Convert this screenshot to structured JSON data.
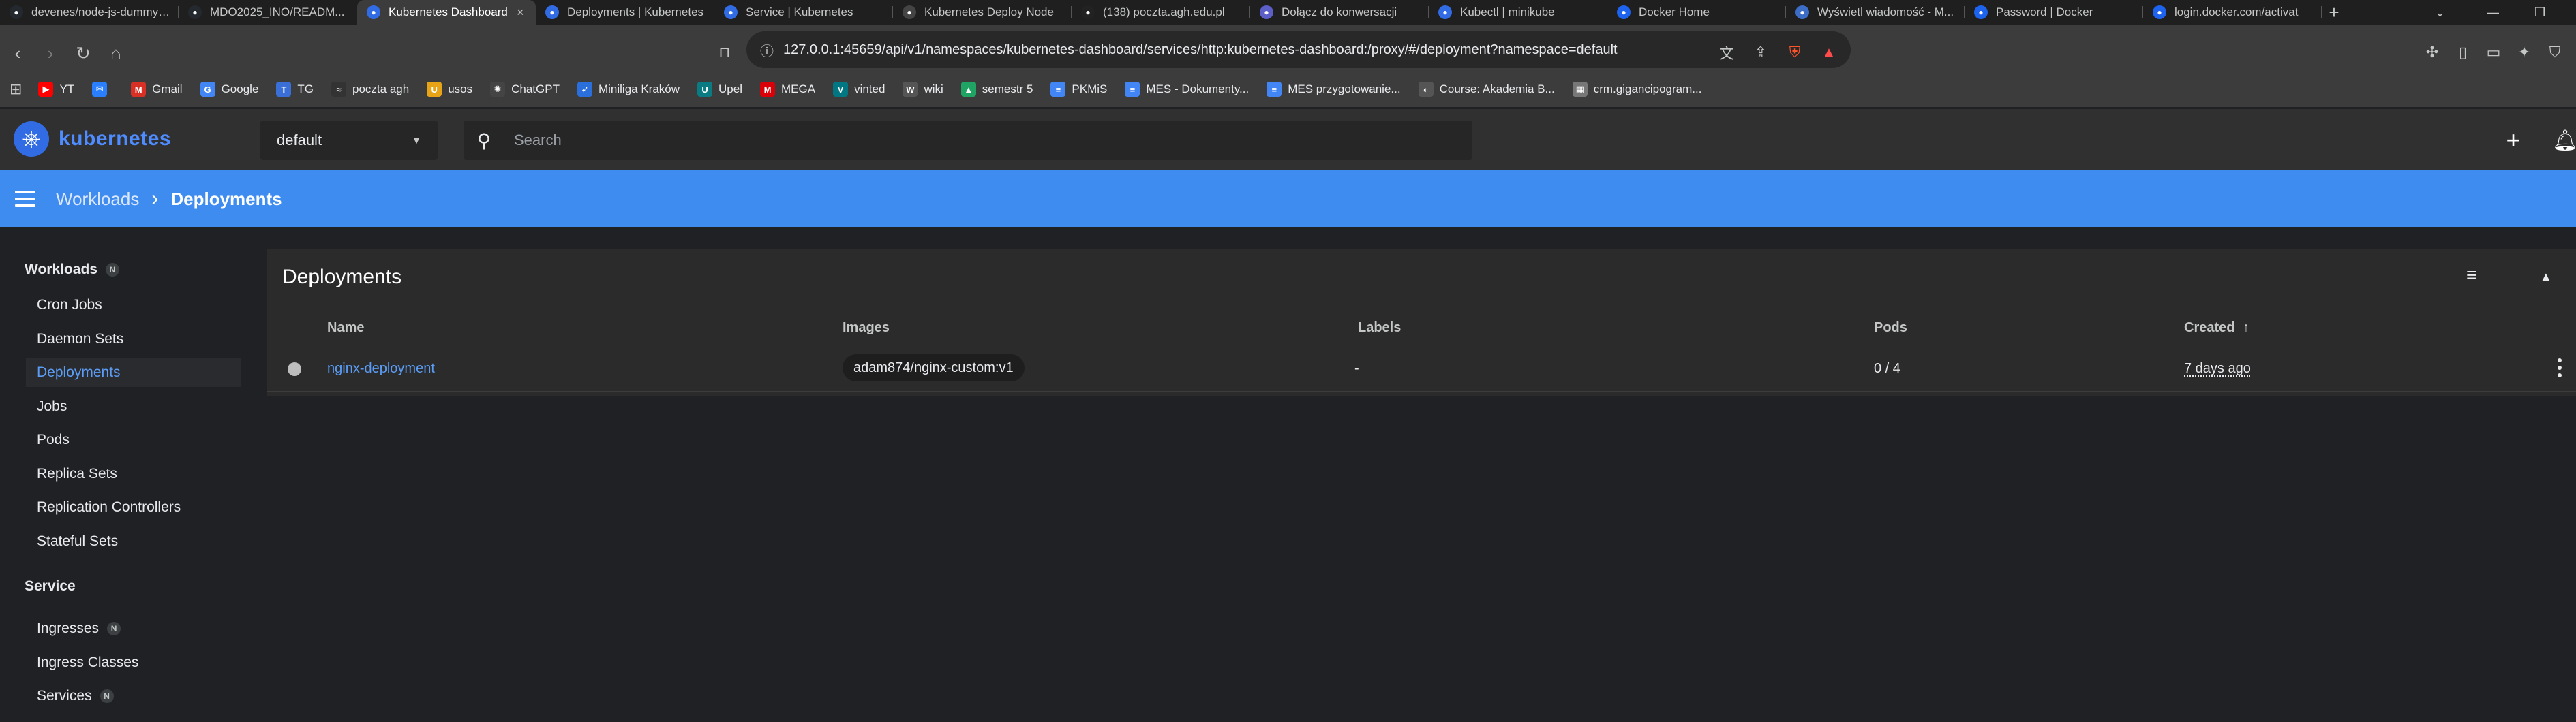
{
  "browser": {
    "tabs": [
      {
        "title": "devenes/node-js-dummy-test",
        "icon": "github-icon",
        "color": "#24292f",
        "active": false
      },
      {
        "title": "MDO2025_INO/READM...",
        "icon": "github-icon",
        "color": "#24292f",
        "active": false
      },
      {
        "title": "Kubernetes Dashboard",
        "icon": "kubernetes-icon",
        "color": "#326ce5",
        "active": true
      },
      {
        "title": "Deployments | Kubernetes",
        "icon": "kubernetes-icon",
        "color": "#326ce5",
        "active": false
      },
      {
        "title": "Service | Kubernetes",
        "icon": "kubernetes-icon",
        "color": "#326ce5",
        "active": false
      },
      {
        "title": "Kubernetes Deploy Node",
        "icon": "openai-icon",
        "color": "#444444",
        "active": false
      },
      {
        "title": "(138) poczta.agh.edu.pl",
        "icon": "mail-icon",
        "color": "#222222",
        "active": false
      },
      {
        "title": "Dołącz do konwersacji",
        "icon": "teams-icon",
        "color": "#5b5fc7",
        "active": false
      },
      {
        "title": "Kubectl | minikube",
        "icon": "minikube-icon",
        "color": "#326ce5",
        "active": false
      },
      {
        "title": "Docker Home",
        "icon": "docker-icon",
        "color": "#1d63ed",
        "active": false
      },
      {
        "title": "Wyświetl wiadomość - M...",
        "icon": "email-icon",
        "color": "#3c6ec7",
        "active": false
      },
      {
        "title": "Password | Docker",
        "icon": "docker-icon",
        "color": "#1d63ed",
        "active": false
      },
      {
        "title": "login.docker.com/activat",
        "icon": "docker-icon",
        "color": "#1d63ed",
        "active": false
      }
    ],
    "new_tab": "+",
    "url": "127.0.0.1:45659/api/v1/namespaces/kubernetes-dashboard/services/http:kubernetes-dashboard:/proxy/#/deployment?namespace=default",
    "bookmarks": [
      {
        "label": "YT",
        "icon": "youtube-icon",
        "color": "#ff0000",
        "glyph": "▶"
      },
      {
        "label": "",
        "icon": "messenger-icon",
        "color": "#2a7fff",
        "glyph": "✉"
      },
      {
        "label": "Gmail",
        "icon": "gmail-icon",
        "color": "#d93025",
        "glyph": "M"
      },
      {
        "label": "Google",
        "icon": "google-icon",
        "color": "#4285f4",
        "glyph": "G"
      },
      {
        "label": "TG",
        "icon": "tg-icon",
        "color": "#3b6fd8",
        "glyph": "T"
      },
      {
        "label": "poczta agh",
        "icon": "poczta-icon",
        "color": "#333333",
        "glyph": "≈"
      },
      {
        "label": "usos",
        "icon": "usos-icon",
        "color": "#e8a317",
        "glyph": "U"
      },
      {
        "label": "ChatGPT",
        "icon": "chatgpt-icon",
        "color": "#444444",
        "glyph": "✺"
      },
      {
        "label": "Miniliga Kraków",
        "icon": "miniliga-icon",
        "color": "#2a6fdb",
        "glyph": "➶"
      },
      {
        "label": "Upel",
        "icon": "upel-icon",
        "color": "#0a7b83",
        "glyph": "U"
      },
      {
        "label": "MEGA",
        "icon": "mega-icon",
        "color": "#d90007",
        "glyph": "M"
      },
      {
        "label": "vinted",
        "icon": "vinted-icon",
        "color": "#007782",
        "glyph": "V"
      },
      {
        "label": "wiki",
        "icon": "wiki-icon",
        "color": "#555555",
        "glyph": "W"
      },
      {
        "label": "semestr 5",
        "icon": "drive-icon",
        "color": "#1fa463",
        "glyph": "▲"
      },
      {
        "label": "PKMiS",
        "icon": "docs-icon",
        "color": "#4285f4",
        "glyph": "≡"
      },
      {
        "label": "MES - Dokumenty...",
        "icon": "docs-icon",
        "color": "#4285f4",
        "glyph": "≡"
      },
      {
        "label": "MES przygotowanie...",
        "icon": "docs-icon",
        "color": "#4285f4",
        "glyph": "≡"
      },
      {
        "label": "Course: Akademia B...",
        "icon": "course-icon",
        "color": "#555555",
        "glyph": "◐"
      },
      {
        "label": "crm.gigancipogram...",
        "icon": "crm-icon",
        "color": "#777777",
        "glyph": "▦"
      }
    ]
  },
  "app": {
    "brand": "kubernetes",
    "namespace": "default",
    "search_placeholder": "Search",
    "add_glyph": "+",
    "breadcrumb": {
      "parent": "Workloads",
      "separator": "›",
      "current": "Deployments"
    },
    "accent_color": "#3f8cf0"
  },
  "sidebar": {
    "workloads": {
      "label": "Workloads",
      "badge": "N"
    },
    "workload_items": [
      {
        "label": "Cron Jobs",
        "active": false
      },
      {
        "label": "Daemon Sets",
        "active": false
      },
      {
        "label": "Deployments",
        "active": true
      },
      {
        "label": "Jobs",
        "active": false
      },
      {
        "label": "Pods",
        "active": false
      },
      {
        "label": "Replica Sets",
        "active": false
      },
      {
        "label": "Replication Controllers",
        "active": false
      },
      {
        "label": "Stateful Sets",
        "active": false
      }
    ],
    "service": {
      "label": "Service"
    },
    "service_items": [
      {
        "label": "Ingresses",
        "badge": "N"
      },
      {
        "label": "Ingress Classes",
        "badge": ""
      },
      {
        "label": "Services",
        "badge": "N"
      }
    ]
  },
  "deployments": {
    "title": "Deployments",
    "columns": {
      "name": "Name",
      "images": "Images",
      "labels": "Labels",
      "pods": "Pods",
      "created": "Created",
      "sort_glyph": "↑"
    },
    "rows": [
      {
        "name": "nginx-deployment",
        "image": "adam874/nginx-custom:v1",
        "labels": "-",
        "pods": "0 / 4",
        "created": "7 days ago"
      }
    ]
  }
}
